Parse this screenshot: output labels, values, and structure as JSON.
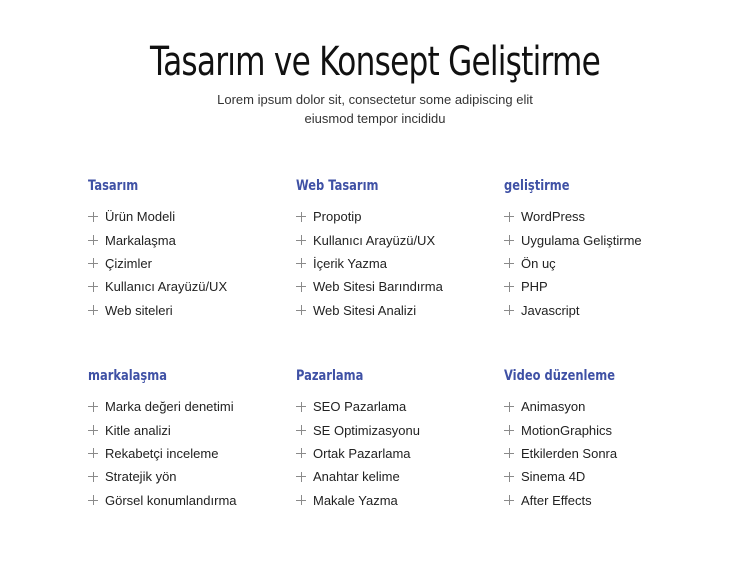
{
  "header": {
    "title": "Tasarım ve Konsept Geliştirme",
    "subtitle_line1": "Lorem ipsum dolor sit, consectetur some adipiscing elit",
    "subtitle_line2": "eiusmod tempor incididu"
  },
  "colors": {
    "accent": "#3f51a5",
    "text": "#222222",
    "icon": "#8a8a8a"
  },
  "list_icon": "plus-icon",
  "groups": [
    {
      "title": "Tasarım",
      "items": [
        "Ürün Modeli",
        "Markalaşma",
        "Çizimler",
        "Kullanıcı Arayüzü/UX",
        "Web siteleri"
      ]
    },
    {
      "title": "Web Tasarım",
      "items": [
        "Propotip",
        "Kullanıcı Arayüzü/UX",
        "İçerik Yazma",
        "Web Sitesi Barındırma",
        "Web Sitesi Analizi"
      ]
    },
    {
      "title": "geliştirme",
      "items": [
        "WordPress",
        "Uygulama Geliştirme",
        "Ön uç",
        "PHP",
        "Javascript"
      ]
    },
    {
      "title": "markalaşma",
      "items": [
        "Marka değeri denetimi",
        "Kitle analizi",
        "Rekabetçi inceleme",
        "Stratejik yön",
        "Görsel konumlandırma"
      ]
    },
    {
      "title": "Pazarlama",
      "items": [
        "SEO Pazarlama",
        "SE Optimizasyonu",
        "Ortak Pazarlama",
        "Anahtar kelime",
        "Makale Yazma"
      ]
    },
    {
      "title": "Video düzenleme",
      "items": [
        "Animasyon",
        "MotionGraphics",
        "Etkilerden Sonra",
        "Sinema 4D",
        "After Effects"
      ]
    }
  ]
}
